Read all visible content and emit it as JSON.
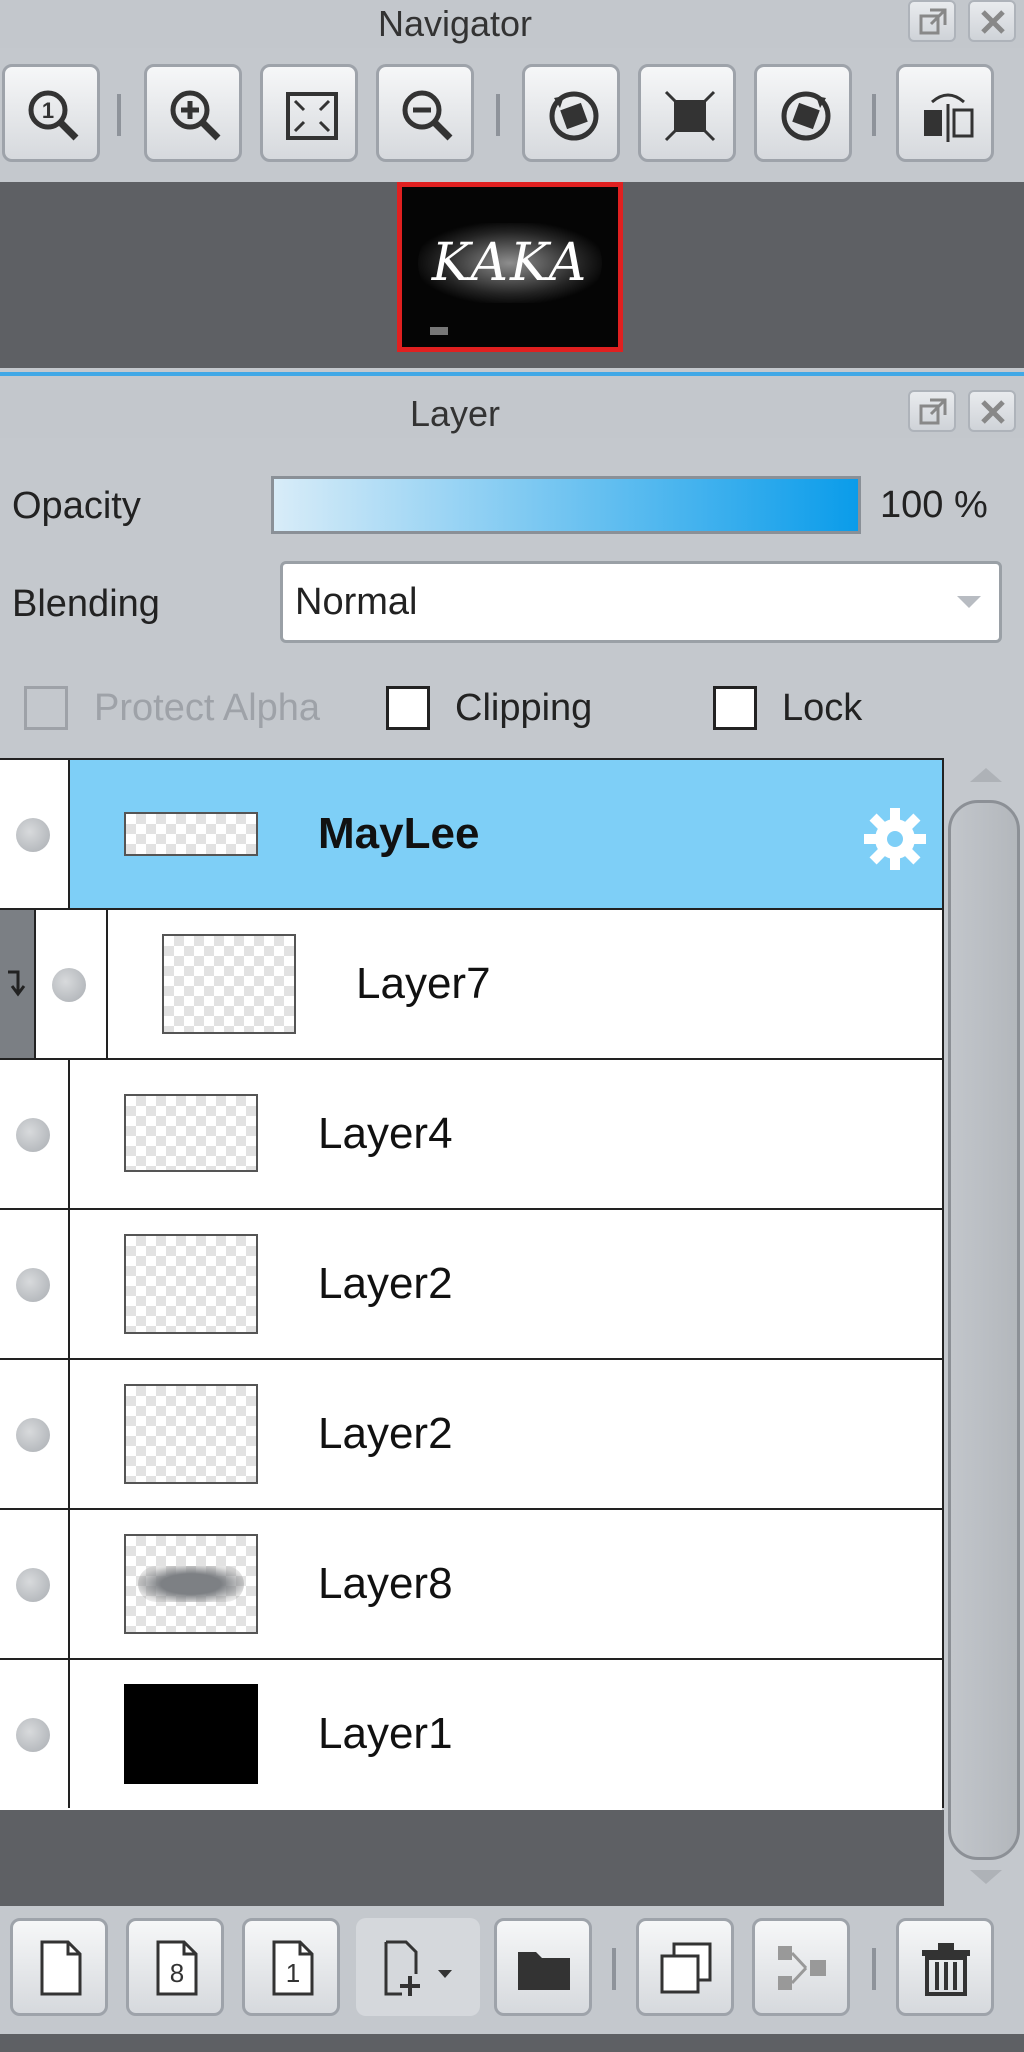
{
  "navigator": {
    "title": "Navigator",
    "tools": [
      {
        "name": "zoom-100-icon",
        "label": ""
      },
      {
        "name": "zoom-in-icon",
        "label": ""
      },
      {
        "name": "fit-screen-icon",
        "label": ""
      },
      {
        "name": "zoom-out-icon",
        "label": ""
      },
      {
        "name": "rotate-left-icon",
        "label": ""
      },
      {
        "name": "reset-rotation-icon",
        "label": ""
      },
      {
        "name": "rotate-right-icon",
        "label": ""
      },
      {
        "name": "flip-horizontal-icon",
        "label": ""
      }
    ],
    "preview_text": "KAKA"
  },
  "layer_panel": {
    "title": "Layer",
    "opacity_label": "Opacity",
    "opacity_value": "100 %",
    "opacity_fraction": 1.0,
    "blending_label": "Blending",
    "blending_value": "Normal",
    "protect_alpha_label": "Protect Alpha",
    "clipping_label": "Clipping",
    "lock_label": "Lock",
    "colors": {
      "accent": "#7ecff7",
      "highlight_border": "#e02020",
      "slider_end": "#0a9cea"
    }
  },
  "layers": [
    {
      "name": "MayLee",
      "selected": true,
      "thumb": "transparent-short"
    },
    {
      "name": "Layer7",
      "clipped": true,
      "thumb": "transparent"
    },
    {
      "name": "Layer4",
      "thumb": "transparent"
    },
    {
      "name": "Layer2",
      "thumb": "transparent"
    },
    {
      "name": "Layer2",
      "thumb": "transparent"
    },
    {
      "name": "Layer8",
      "thumb": "blurred-text"
    },
    {
      "name": "Layer1",
      "thumb": "black"
    }
  ],
  "bottom_tools": [
    {
      "name": "new-layer-icon"
    },
    {
      "name": "new-8bit-layer-icon",
      "label": "8"
    },
    {
      "name": "new-1bit-layer-icon",
      "label": "1"
    },
    {
      "name": "add-layer-dropdown-icon"
    },
    {
      "name": "new-folder-icon"
    },
    {
      "name": "duplicate-layer-icon"
    },
    {
      "name": "merge-down-icon"
    },
    {
      "name": "delete-layer-icon"
    }
  ]
}
